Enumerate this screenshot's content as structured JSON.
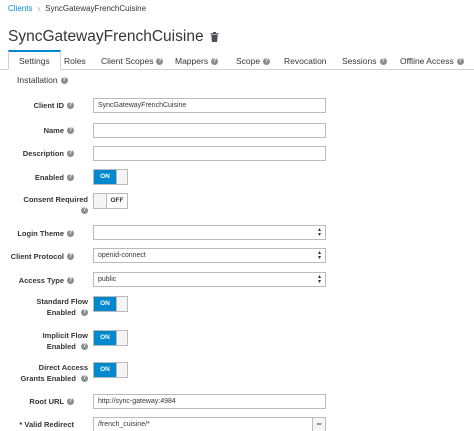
{
  "breadcrumb": {
    "parent": "Clients",
    "separator": "›",
    "current": "SyncGatewayFrenchCuisine"
  },
  "page": {
    "title": "SyncGatewayFrenchCuisine"
  },
  "tabs": [
    {
      "label": "Settings",
      "active": true
    },
    {
      "label": "Roles"
    },
    {
      "label": "Client Scopes"
    },
    {
      "label": "Mappers"
    },
    {
      "label": "Scope"
    },
    {
      "label": "Revocation"
    },
    {
      "label": "Sessions"
    },
    {
      "label": "Offline Access"
    },
    {
      "label": "Installation"
    }
  ],
  "help_glyph": "?",
  "form": {
    "client_id": {
      "label": "Client ID",
      "value": "SyncGatewayFrenchCuisine"
    },
    "name": {
      "label": "Name",
      "value": ""
    },
    "description": {
      "label": "Description",
      "value": ""
    },
    "enabled": {
      "label": "Enabled",
      "state": "ON"
    },
    "consent_required": {
      "label": "Consent Required",
      "state": "OFF"
    },
    "login_theme": {
      "label": "Login Theme",
      "value": ""
    },
    "client_protocol": {
      "label": "Client Protocol",
      "value": "openid-connect"
    },
    "access_type": {
      "label": "Access Type",
      "value": "public"
    },
    "standard_flow": {
      "label_line1": "Standard Flow",
      "label_line2": "Enabled",
      "state": "ON"
    },
    "implicit_flow": {
      "label_line1": "Implicit Flow",
      "label_line2": "Enabled",
      "state": "ON"
    },
    "direct_access": {
      "label_line1": "Direct Access",
      "label_line2": "Grants Enabled",
      "state": "ON"
    },
    "root_url": {
      "label": "Root URL",
      "value": "http://sync-gateway:4984"
    },
    "valid_redirect": {
      "label": "* Valid Redirect",
      "value": "/french_cuisine/*",
      "remove_label": "−"
    }
  },
  "colors": {
    "accent": "#0088ce",
    "border": "#bbbbbb",
    "text": "#363636"
  }
}
